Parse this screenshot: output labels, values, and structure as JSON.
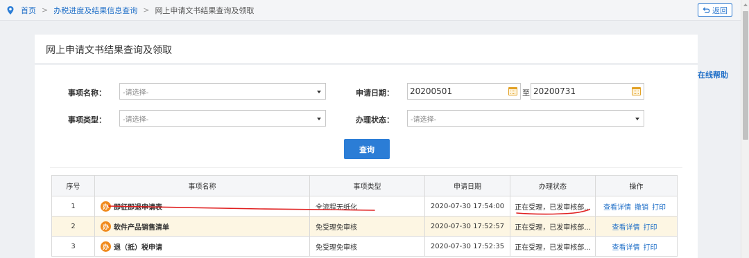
{
  "breadcrumb": {
    "home": "首页",
    "level2": "办税进度及结果信息查询",
    "current": "网上申请文书结果查询及领取",
    "separator": ">"
  },
  "back_label": "返回",
  "help_label": "在线帮助",
  "panel_title": "网上申请文书结果查询及领取",
  "form": {
    "item_name_label": "事项名称：",
    "item_name_value": "-请选择-",
    "item_type_label": "事项类型：",
    "item_type_value": "-请选择-",
    "apply_date_label": "申请日期：",
    "date_from": "20200501",
    "date_to_sep": "至",
    "date_to": "20200731",
    "status_label": "办理状态：",
    "status_value": "-请选择-"
  },
  "query_label": "查询",
  "table": {
    "headers": [
      "序号",
      "事项名称",
      "事项类型",
      "申请日期",
      "办理状态",
      "操作"
    ],
    "rows": [
      {
        "no": "1",
        "badge": "办",
        "name": "即征即退申请表",
        "type": "全流程无纸化",
        "date": "2020-07-30 17:54:00",
        "status": "正在受理，已发审核部...",
        "ops": [
          "查看详情",
          "撤销",
          "打印"
        ]
      },
      {
        "no": "2",
        "badge": "办",
        "name": "软件产品销售清单",
        "type": "免受理免审核",
        "date": "2020-07-30 17:52:57",
        "status": "正在受理，已发审核部...",
        "ops": [
          "查看详情",
          "打印"
        ]
      },
      {
        "no": "3",
        "badge": "办",
        "name": "退（抵）税申请",
        "type": "免受理免审核",
        "date": "2020-07-30 17:52:35",
        "status": "正在受理，已发审核部...",
        "ops": [
          "查看详情",
          "打印"
        ]
      }
    ]
  },
  "colors": {
    "accent": "#2b7dd6",
    "link": "#2170c8",
    "badge": "#f08a1d",
    "highlight_row": "#fdf6e3",
    "annotation": "#e02020"
  },
  "icons": [
    "location-pin-icon",
    "return-arrow-icon",
    "calendar-icon",
    "chevron-down-icon",
    "scroll-up-arrow-icon"
  ]
}
